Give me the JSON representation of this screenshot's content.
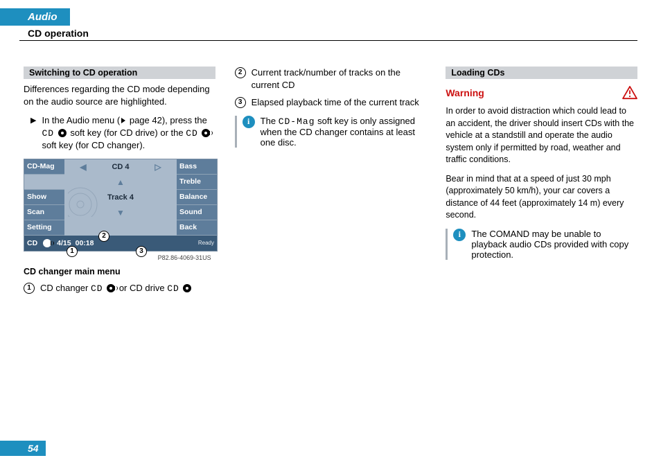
{
  "header": {
    "tab": "Audio",
    "section": "CD operation",
    "page_number": "54"
  },
  "col1": {
    "heading": "Switching to CD operation",
    "intro": "Differences regarding the CD mode depending on the audio source are highlighted.",
    "instr_pre": "In the Audio menu (",
    "instr_pageref": "page 42",
    "instr_mid1": "), press the ",
    "instr_cd": "CD",
    "instr_mid2": " soft key (for CD drive) or the ",
    "instr_mid3": " soft key (for CD changer).",
    "screenshot": {
      "left_keys": [
        "CD-Mag",
        "",
        "Show",
        "Scan",
        "Setting"
      ],
      "right_keys": [
        "Bass",
        "Treble",
        "Balance",
        "Sound",
        "Back"
      ],
      "top_label": "CD 4",
      "track_label": "Track 4",
      "status_cd": "CD",
      "status_count": "4/15",
      "status_time": "00:18",
      "status_ready": "Ready",
      "ref": "P82.86-4069-31US"
    },
    "caption": "CD changer main menu",
    "item1_pre": "CD changer ",
    "item1_mid": " or CD drive "
  },
  "col2": {
    "item2": "Current track/number of tracks on the current CD",
    "item3": "Elapsed playback time of the current track",
    "info_pre": "The ",
    "info_key": "CD-Mag",
    "info_post": " soft key is only assigned when the CD changer contains at least one disc."
  },
  "col3": {
    "heading": "Loading CDs",
    "warning_label": "Warning",
    "warn_p1": "In order to avoid distraction which could lead to an accident, the driver should insert CDs with the vehicle at a standstill and operate the audio system only if permitted by road, weather and traffic conditions.",
    "warn_p2": "Bear in mind that at a speed of just 30 mph (approximately 50 km/h), your car covers a distance of 44 feet (approximately 14 m) every second.",
    "info2": "The COMAND may be unable to playback audio CDs provided with copy protection."
  }
}
